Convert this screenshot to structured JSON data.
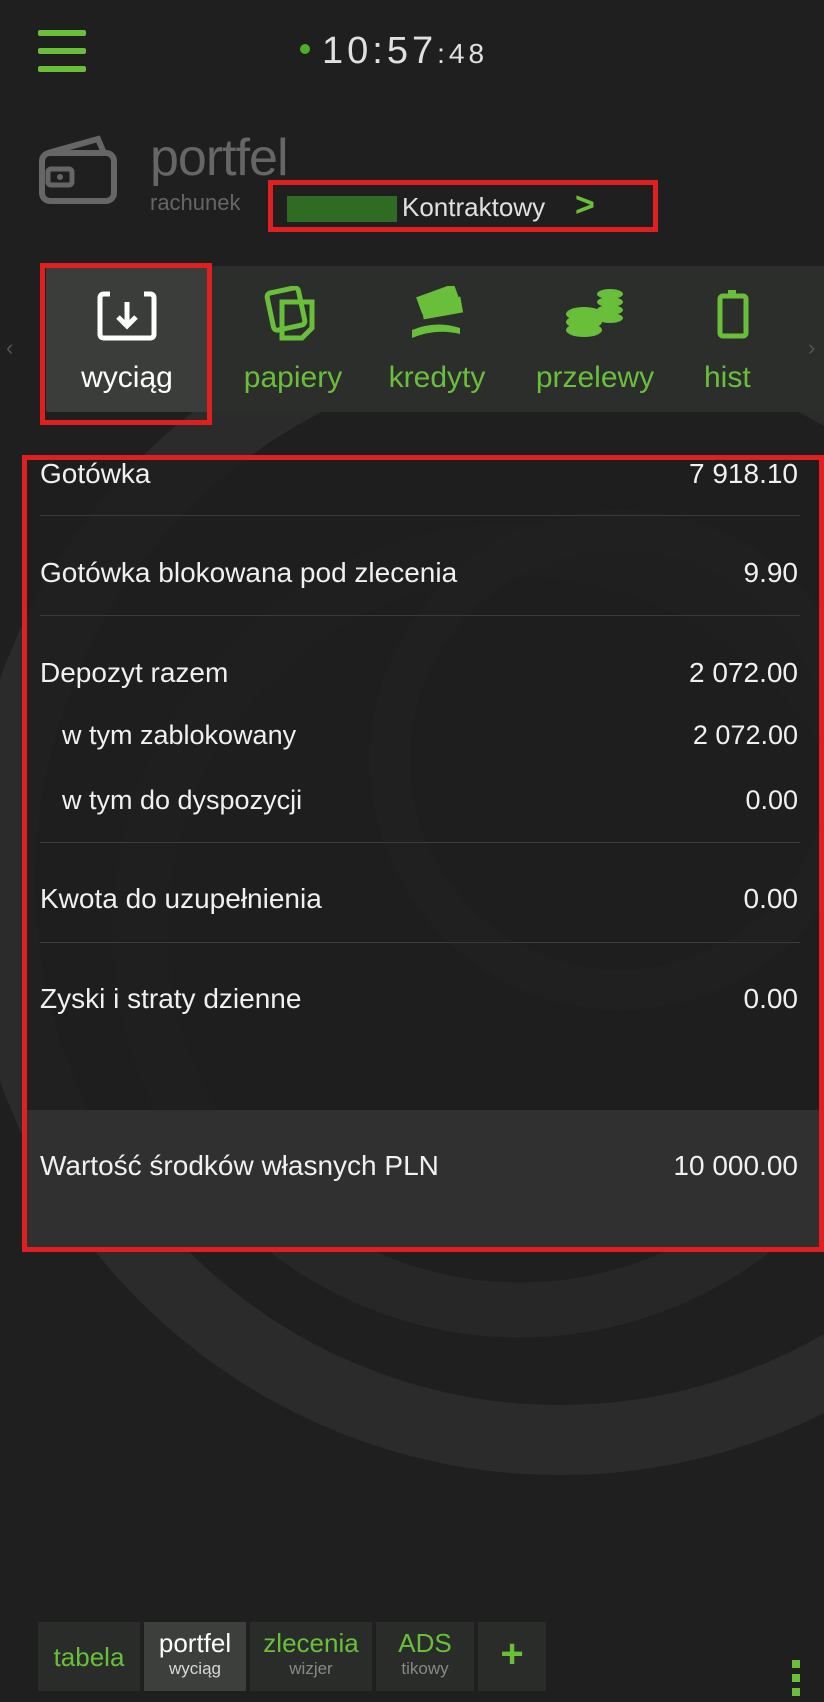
{
  "clock": {
    "time": "10:57",
    "seconds": ":48"
  },
  "header": {
    "title": "portfel",
    "account_label": "rachunek",
    "account_type": "Kontraktowy",
    "chevron": ">"
  },
  "tabs": [
    {
      "label": "wyciąg",
      "icon": "download-icon",
      "active": true
    },
    {
      "label": "papiery",
      "icon": "papers-icon"
    },
    {
      "label": "kredyty",
      "icon": "credit-hand-icon"
    },
    {
      "label": "przelewy",
      "icon": "coins-icon"
    },
    {
      "label": "hist",
      "icon": "history-icon"
    }
  ],
  "summary": {
    "rows": [
      {
        "label": "Gotówka",
        "value": "7 918.10"
      },
      {
        "label": "Gotówka blokowana pod zlecenia",
        "value": "9.90"
      },
      {
        "label": "Depozyt razem",
        "value": "2 072.00"
      },
      {
        "label": "w tym zablokowany",
        "value": "2 072.00"
      },
      {
        "label": "w tym do dyspozycji",
        "value": "0.00"
      },
      {
        "label": "Kwota do uzupełnienia",
        "value": "0.00"
      },
      {
        "label": "Zyski i straty dzienne",
        "value": "0.00"
      }
    ],
    "total": {
      "label": "Wartość środków własnych PLN",
      "value": "10 000.00"
    }
  },
  "bottom_tabs": [
    {
      "label": "tabela"
    },
    {
      "label": "portfel",
      "sub": "wyciąg",
      "active": true
    },
    {
      "label": "zlecenia",
      "sub": "wizjer"
    },
    {
      "label": "ADS",
      "sub": "tikowy"
    }
  ],
  "add_tab": "+",
  "colors": {
    "accent": "#6abf3a",
    "highlight": "#e02020",
    "background": "#1e1f1e"
  }
}
